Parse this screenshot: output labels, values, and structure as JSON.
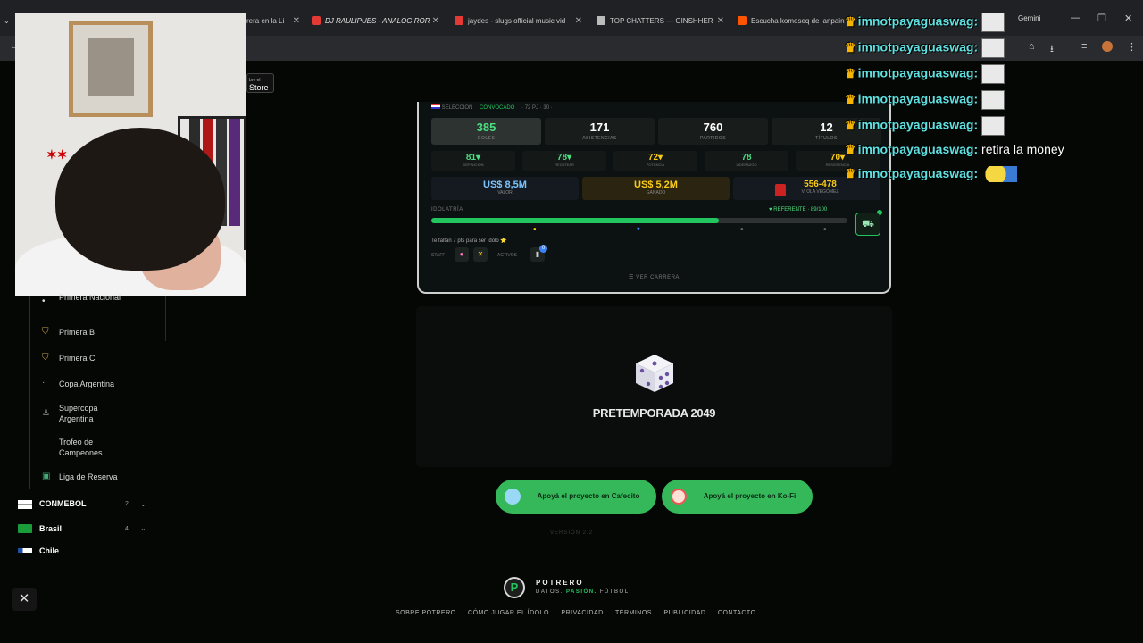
{
  "browser": {
    "tabs": [
      {
        "title": "rera en la Li"
      },
      {
        "title": "DJ RAULIPUES - ANALOG ROR"
      },
      {
        "title": "jaydes - slugs official music vid"
      },
      {
        "title": "TOP CHATTERS — GINSHHER"
      },
      {
        "title": "Escucha komoseq de lanpain"
      }
    ],
    "gemini_label": "Gemini"
  },
  "store_chip": {
    "small": "bre el",
    "label": "Store"
  },
  "sidebar": {
    "items": [
      {
        "label": "Primera Nacional"
      },
      {
        "label": "Primera B"
      },
      {
        "label": "Primera C"
      },
      {
        "label": "Copa Argentina"
      },
      {
        "label": "Supercopa Argentina"
      },
      {
        "label": "Trofeo de Campeones"
      },
      {
        "label": "Liga de Reserva"
      }
    ],
    "groups": [
      {
        "label": "CONMEBOL",
        "count": "2"
      },
      {
        "label": "Brasil",
        "count": "4"
      },
      {
        "label": "Chile",
        "count": ""
      }
    ]
  },
  "career": {
    "selection_label": "SELECCIÓN",
    "selection_badge": "CONVOCADO",
    "selection_extra": "· 72 PJ · 30 ·",
    "stats": [
      {
        "value": "385",
        "label": "GOLES"
      },
      {
        "value": "171",
        "label": "ASISTENCIAS"
      },
      {
        "value": "760",
        "label": "PARTIDOS"
      },
      {
        "value": "12",
        "label": "TÍTULOS"
      }
    ],
    "attributes": [
      {
        "value": "81▾",
        "label": "DEFINICIÓN"
      },
      {
        "value": "78▾",
        "label": "REGATEAR"
      },
      {
        "value": "72▾",
        "label": "POTENCIA"
      },
      {
        "value": "78",
        "label": "LIDERAZGO"
      },
      {
        "value": "70▾",
        "label": "RESISTENCIA"
      }
    ],
    "money": [
      {
        "value": "US$ 8,5M",
        "label": "VALOR"
      },
      {
        "value": "US$ 5,2M",
        "label": "GANADO"
      }
    ],
    "record": {
      "value": "556-478",
      "label": "V. OLA VEGÓMEZ"
    },
    "idolatry_label": "IDOLATRÍA",
    "idolatry_status": "♥ REFERENTE · 89/100",
    "idolatry_level": 0.69,
    "hint": "Te faltan 7 pts para ser ídolo ⭐",
    "staff_label": "STAFF",
    "activos_label": "ACTIVOS",
    "badge_count": "0",
    "view_career": "☰ VER CARRERA"
  },
  "preseason": {
    "title": "PRETEMPORADA 2049"
  },
  "support": {
    "cafecito": "Apoyá el proyecto en Cafecito",
    "kofi": "Apoyá el proyecto en Ko-Fi"
  },
  "version": "VERSIÓN 2.2",
  "footer": {
    "brand": "POTRERO",
    "tagline_1": "DATOS.",
    "tagline_2": "PASIÓN.",
    "tagline_3": "FÚTBOL.",
    "links": [
      "SOBRE POTRERO",
      "CÓMO JUGAR EL ÍDOLO",
      "PRIVACIDAD",
      "TÉRMINOS",
      "PUBLICIDAD",
      "CONTACTO"
    ]
  },
  "chat": {
    "username": "imnotpayaguaswag:",
    "messages": [
      "",
      "",
      "",
      "",
      "",
      "retira la money",
      ""
    ]
  },
  "colors": {
    "accent": "#22c55e",
    "gold": "#facc15",
    "chat_name": "#5fe1e1"
  }
}
